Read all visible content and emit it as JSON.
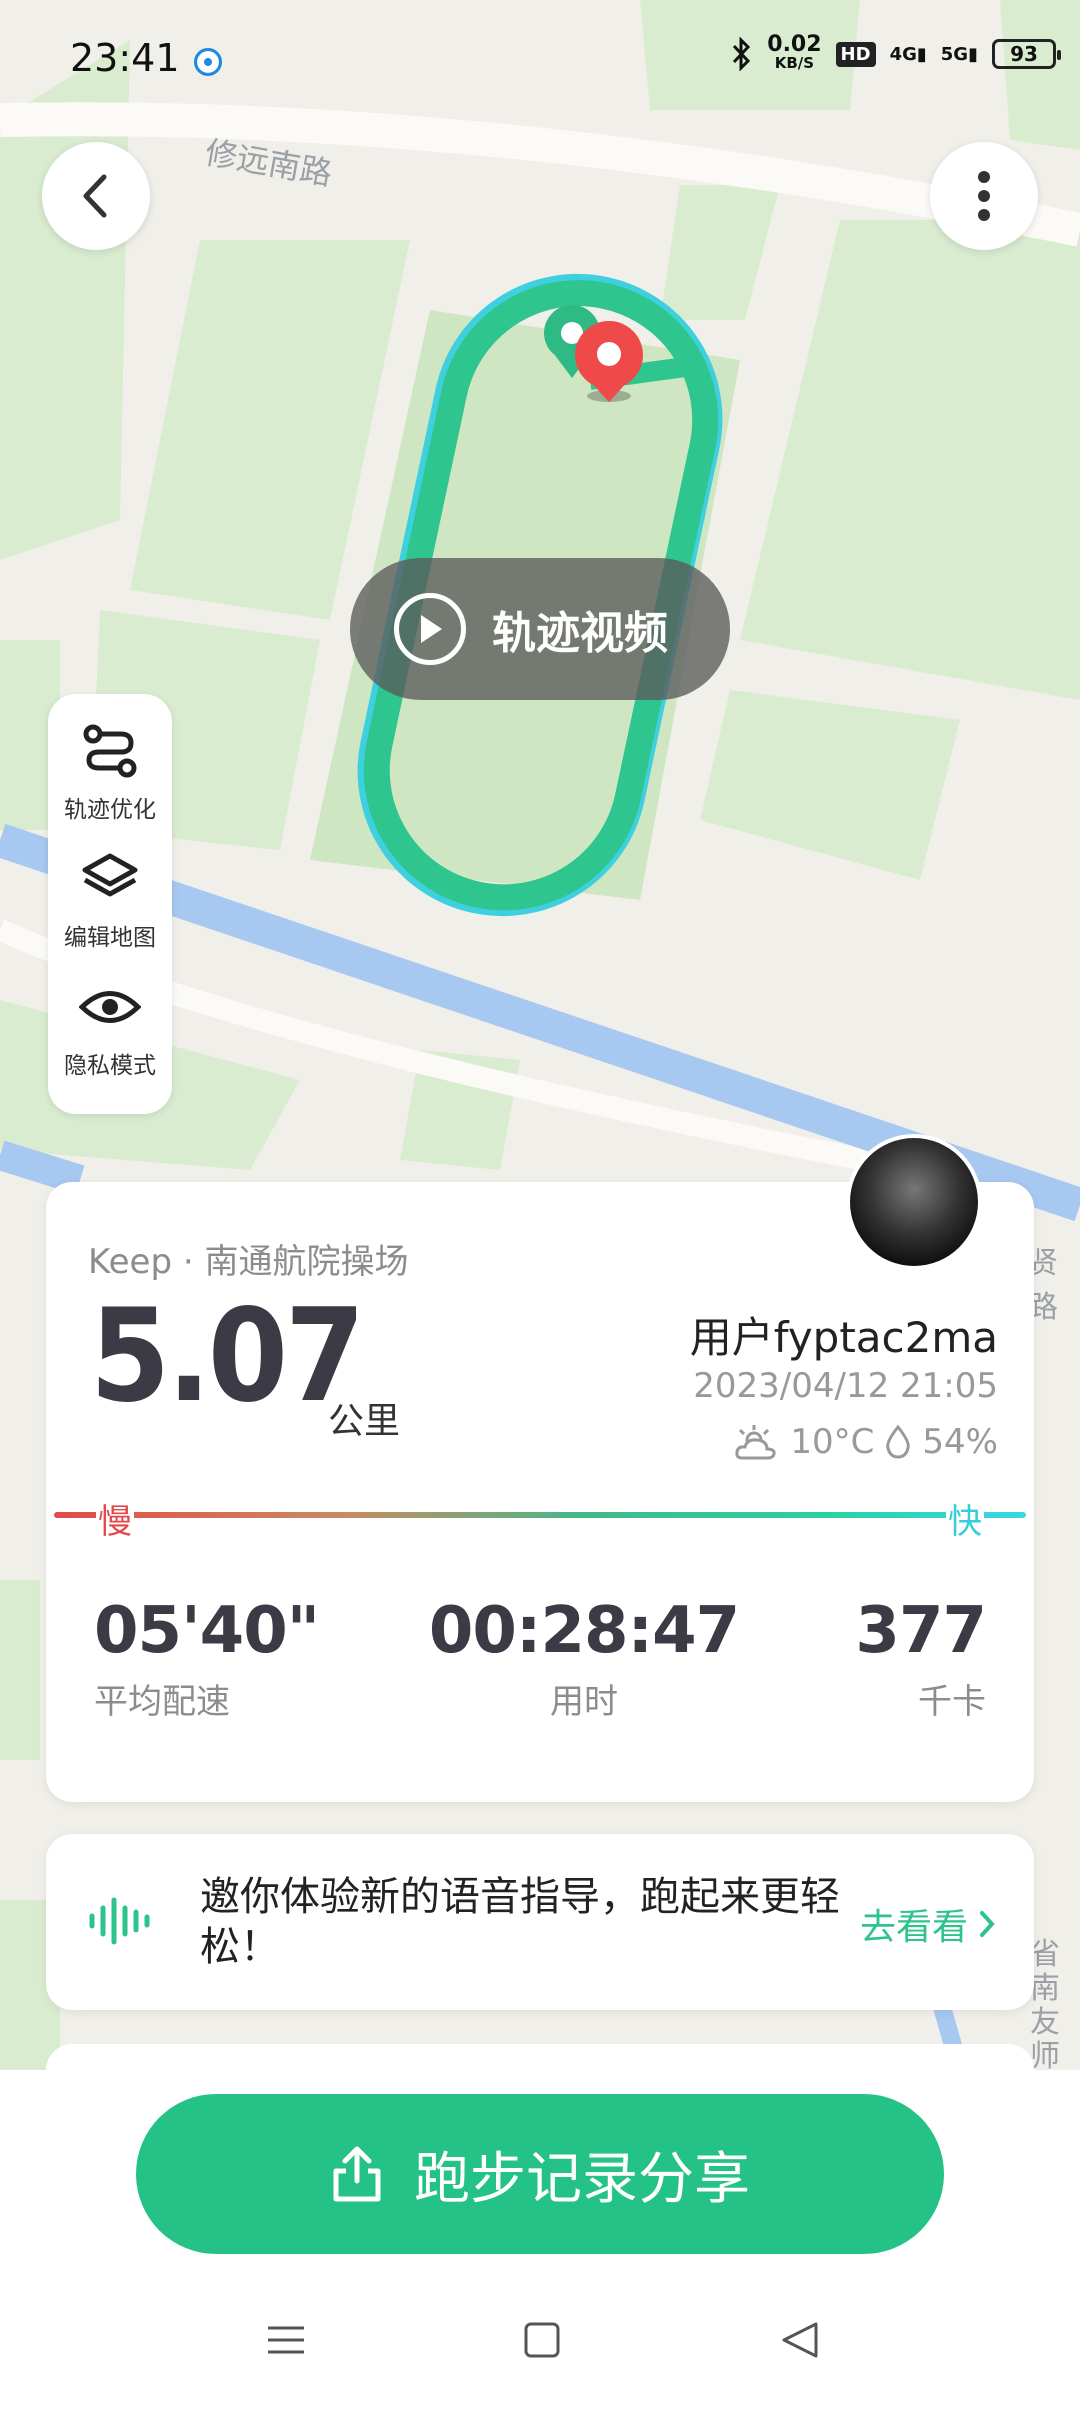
{
  "status_bar": {
    "time": "23:41",
    "net_speed_value": "0.02",
    "net_speed_unit": "KB/S",
    "hd_badge": "HD",
    "signal_4g": "4G",
    "signal_5g": "5G",
    "battery": "93"
  },
  "map": {
    "road_label": "修远南路",
    "road_label_right": "贤路",
    "road_label_bottom": "省南 友师"
  },
  "video_button": {
    "label": "轨迹视频"
  },
  "tools": [
    {
      "label": "轨迹优化",
      "icon": "route-icon"
    },
    {
      "label": "编辑地图",
      "icon": "layers-icon"
    },
    {
      "label": "隐私模式",
      "icon": "eye-icon"
    }
  ],
  "summary": {
    "place": "Keep · 南通航院操场",
    "distance": "5.07",
    "distance_unit": "公里",
    "user": "用户fyptac2ma",
    "datetime": "2023/04/12 21:05",
    "temperature": "10°C",
    "humidity": "54%",
    "pace_slow_label": "慢",
    "pace_fast_label": "快",
    "stats": [
      {
        "value": "05'40\"",
        "label": "平均配速"
      },
      {
        "value": "00:28:47",
        "label": "用时"
      },
      {
        "value": "377",
        "label": "千卡"
      }
    ]
  },
  "voice_banner": {
    "text": "邀你体验新的语音指导，跑起来更轻松！",
    "link": "去看看"
  },
  "share_button": {
    "label": "跑步记录分享"
  },
  "colors": {
    "accent": "#25c287",
    "slow": "#e24a4a",
    "fast": "#36cfd7"
  }
}
